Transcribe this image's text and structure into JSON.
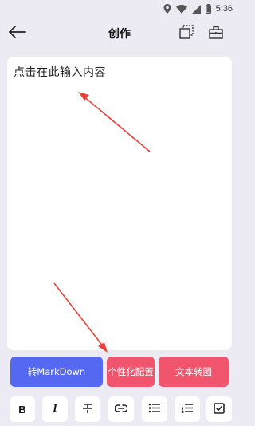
{
  "status_bar": {
    "time": "5:36",
    "icons": [
      "location-icon",
      "wifi-icon",
      "signal-icon",
      "battery-icon"
    ]
  },
  "app_bar": {
    "title": "创作",
    "back_icon": "arrow-left-icon",
    "actions": [
      "copy-icon",
      "toolbox-icon"
    ]
  },
  "editor": {
    "placeholder": "点击在此输入内容"
  },
  "actions": {
    "markdown_label": "转MarkDown",
    "personalize_label": "个性化配置",
    "text_to_image_label": "文本转图"
  },
  "format_toolbar": {
    "bold": "B",
    "italic": "I",
    "items": [
      "bold-icon",
      "italic-icon",
      "strikethrough-icon",
      "link-icon",
      "bullet-list-icon",
      "numbered-list-icon",
      "checkbox-icon"
    ]
  },
  "colors": {
    "background": "#eceaf3",
    "markdown_button": "#5468f2",
    "pink_button": "#f0556d",
    "annotation_arrow": "#e8413a"
  }
}
